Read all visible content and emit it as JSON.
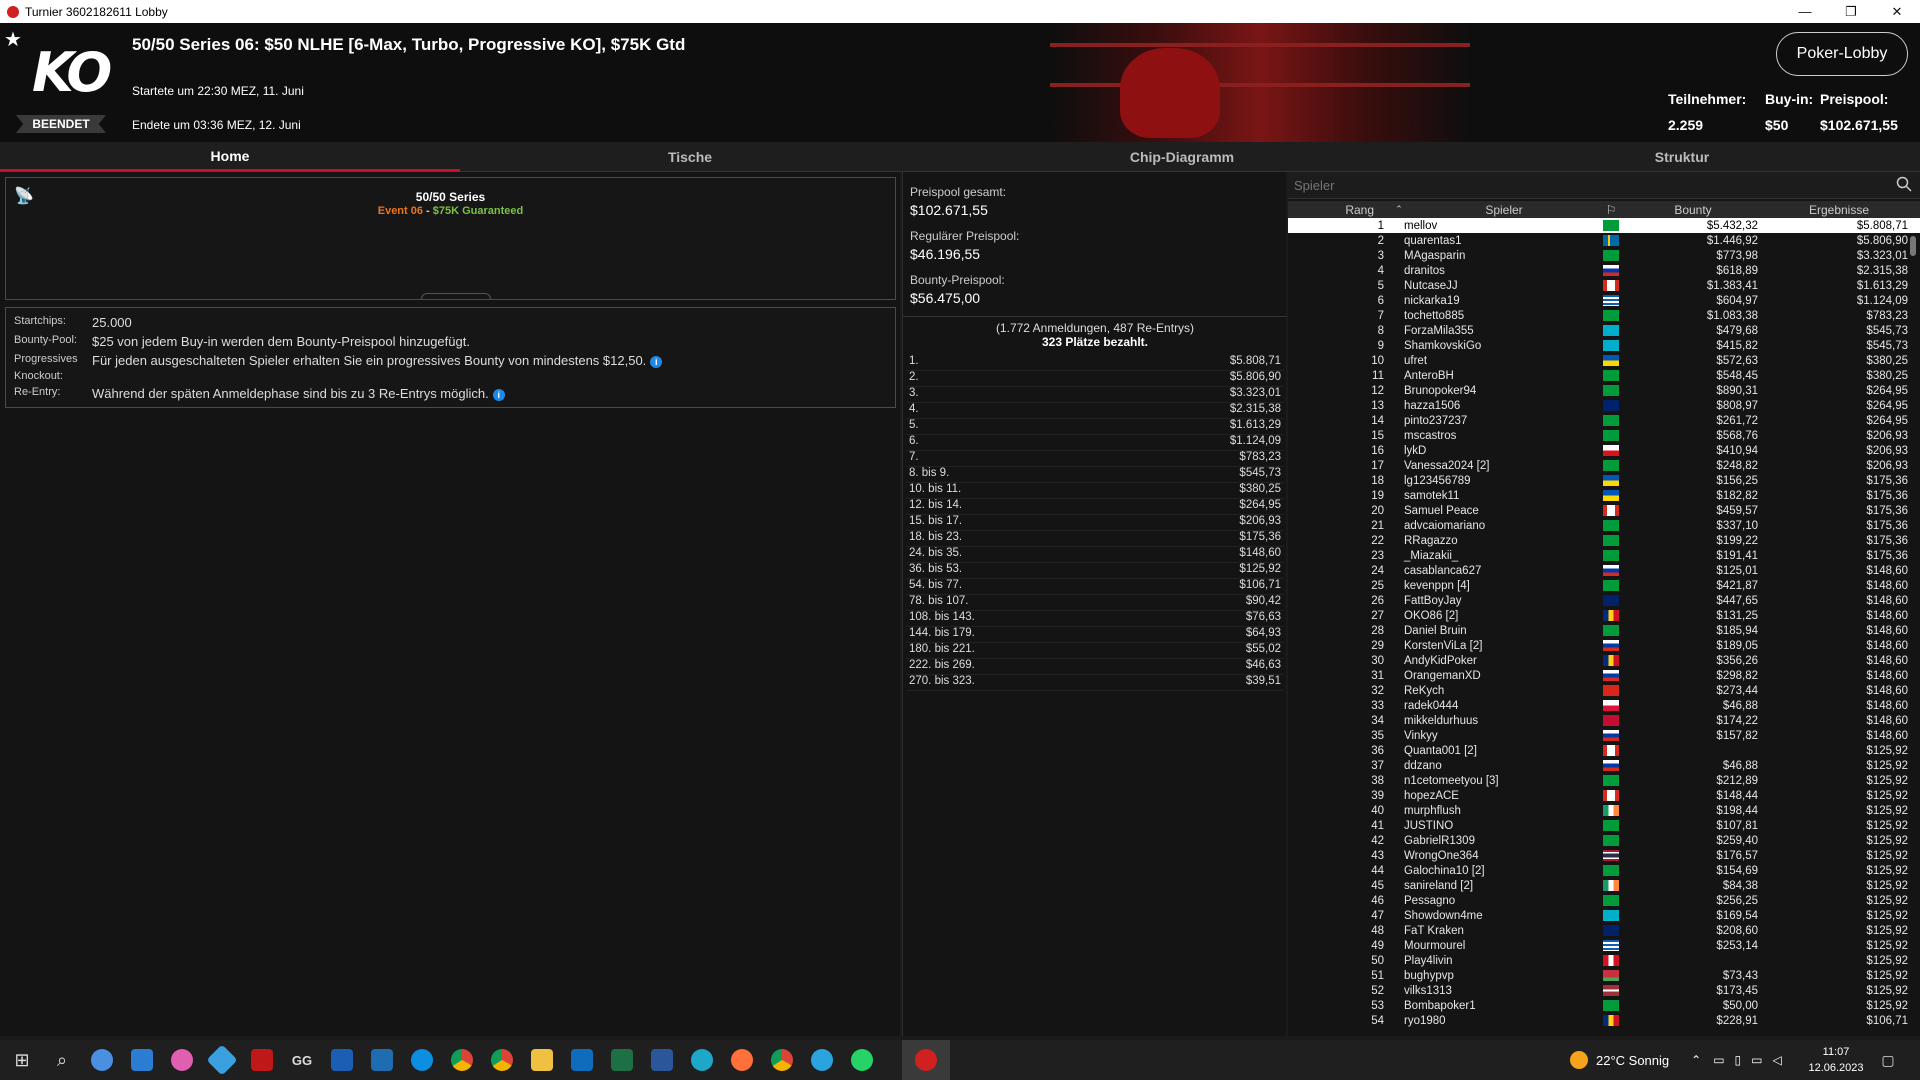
{
  "window": {
    "title": "Turnier 3602182611 Lobby",
    "min": "—",
    "max": "❐",
    "close": "✕"
  },
  "header": {
    "logo": "KO",
    "status_badge": "BEENDET",
    "title": "50/50 Series 06: $50 NLHE [6-Max, Turbo, Progressive KO], $75K Gtd",
    "start": "Startete um 22:30 MEZ, 11. Juni",
    "end": "Endete um 03:36 MEZ, 12. Juni",
    "lobby_button": "Poker-Lobby",
    "stats": {
      "participants_label": "Teilnehmer:",
      "participants": "2.259",
      "buyin_label": "Buy-in:",
      "buyin": "$50",
      "prizepool_label": "Preispool:",
      "prizepool": "$102.671,55"
    }
  },
  "tabs": [
    {
      "label": "Home",
      "active": true
    },
    {
      "label": "Tische"
    },
    {
      "label": "Chip-Diagramm"
    },
    {
      "label": "Struktur"
    }
  ],
  "series": {
    "name": "50/50 Series",
    "event": "Event 06",
    "dash": " - ",
    "guarantee": "$75K Guaranteed"
  },
  "info": [
    {
      "key": "Startchips:",
      "value": "25.000"
    },
    {
      "key": "Bounty-Pool:",
      "value": "$25 von jedem Buy-in werden dem Bounty-Preispool hinzugefügt."
    },
    {
      "key": "Progressives",
      "value": "Für jeden ausgeschalteten Spieler erhalten Sie ein progressives Bounty von mindestens $12,50."
    },
    {
      "key": "Knockout:",
      "value": ""
    },
    {
      "key": "Re-Entry:",
      "value": "Während der späten Anmeldephase sind bis zu 3 Re-Entrys möglich."
    }
  ],
  "pools": {
    "total_label": "Preispool gesamt:",
    "total": "$102.671,55",
    "regular_label": "Regulärer Preispool:",
    "regular": "$46.196,55",
    "bounty_label": "Bounty-Preispool:",
    "bounty": "$56.475,00"
  },
  "registrations": {
    "summary": "(1.772 Anmeldungen, 487 Re-Entrys)",
    "paid": "323 Plätze bezahlt."
  },
  "payouts": [
    [
      "1.",
      "$5.808,71"
    ],
    [
      "2.",
      "$5.806,90"
    ],
    [
      "3.",
      "$3.323,01"
    ],
    [
      "4.",
      "$2.315,38"
    ],
    [
      "5.",
      "$1.613,29"
    ],
    [
      "6.",
      "$1.124,09"
    ],
    [
      "7.",
      "$783,23"
    ],
    [
      "8. bis 9.",
      "$545,73"
    ],
    [
      "10. bis 11.",
      "$380,25"
    ],
    [
      "12. bis 14.",
      "$264,95"
    ],
    [
      "15. bis 17.",
      "$206,93"
    ],
    [
      "18. bis 23.",
      "$175,36"
    ],
    [
      "24. bis 35.",
      "$148,60"
    ],
    [
      "36. bis 53.",
      "$125,92"
    ],
    [
      "54. bis 77.",
      "$106,71"
    ],
    [
      "78. bis 107.",
      "$90,42"
    ],
    [
      "108. bis 143.",
      "$76,63"
    ],
    [
      "144. bis 179.",
      "$64,93"
    ],
    [
      "180. bis 221.",
      "$55,02"
    ],
    [
      "222. bis 269.",
      "$46,63"
    ],
    [
      "270. bis 323.",
      "$39,51"
    ]
  ],
  "players_search": {
    "placeholder": "Spieler"
  },
  "players_header": {
    "rank": "Rang",
    "player": "Spieler",
    "bounty": "Bounty",
    "result": "Ergebnisse"
  },
  "players": [
    [
      "1",
      "mellov",
      "br",
      "$5.432,32",
      "$5.808,71"
    ],
    [
      "2",
      "quarentas1",
      "se",
      "$1.446,92",
      "$5.806,90"
    ],
    [
      "3",
      "MAgasparin",
      "br",
      "$773,98",
      "$3.323,01"
    ],
    [
      "4",
      "dranitos",
      "ru",
      "$618,89",
      "$2.315,38"
    ],
    [
      "5",
      "NutcaseJJ",
      "ca",
      "$1.383,41",
      "$1.613,29"
    ],
    [
      "6",
      "nickarka19",
      "gr",
      "$604,97",
      "$1.124,09"
    ],
    [
      "7",
      "tochetto885",
      "br",
      "$1.083,38",
      "$783,23"
    ],
    [
      "8",
      "ForzaMila355",
      "kz",
      "$479,68",
      "$545,73"
    ],
    [
      "9",
      "ShamkovskiGo",
      "kz",
      "$415,82",
      "$545,73"
    ],
    [
      "10",
      "ufret",
      "ua",
      "$572,63",
      "$380,25"
    ],
    [
      "11",
      "AnteroBH",
      "br",
      "$548,45",
      "$380,25"
    ],
    [
      "12",
      "Brunopoker94",
      "br",
      "$890,31",
      "$264,95"
    ],
    [
      "13",
      "hazza1506",
      "gb",
      "$808,97",
      "$264,95"
    ],
    [
      "14",
      "pinto237237",
      "br",
      "$261,72",
      "$264,95"
    ],
    [
      "15",
      "mscastros",
      "br",
      "$568,76",
      "$206,93"
    ],
    [
      "16",
      "lykD",
      "cz",
      "$410,94",
      "$206,93"
    ],
    [
      "17",
      "Vanessa2024 [2]",
      "br",
      "$248,82",
      "$206,93"
    ],
    [
      "18",
      "lg123456789",
      "ua",
      "$156,25",
      "$175,36"
    ],
    [
      "19",
      "samotek11",
      "ua",
      "$182,82",
      "$175,36"
    ],
    [
      "20",
      "Samuel Peace",
      "ca",
      "$459,57",
      "$175,36"
    ],
    [
      "21",
      "advcaiomariano",
      "br",
      "$337,10",
      "$175,36"
    ],
    [
      "22",
      "RRagazzo",
      "br",
      "$199,22",
      "$175,36"
    ],
    [
      "23",
      "_Miazakii_",
      "br",
      "$191,41",
      "$175,36"
    ],
    [
      "24",
      "casablanca627",
      "ru",
      "$125,01",
      "$148,60"
    ],
    [
      "25",
      "kevenppn [4]",
      "br",
      "$421,87",
      "$148,60"
    ],
    [
      "26",
      "FattBoyJay",
      "gb",
      "$447,65",
      "$148,60"
    ],
    [
      "27",
      "OKO86 [2]",
      "ro",
      "$131,25",
      "$148,60"
    ],
    [
      "28",
      "Daniel Bruin",
      "br",
      "$185,94",
      "$148,60"
    ],
    [
      "29",
      "KorstenViLa [2]",
      "ru",
      "$189,05",
      "$148,60"
    ],
    [
      "30",
      "AndyKidPoker",
      "ro",
      "$356,26",
      "$148,60"
    ],
    [
      "31",
      "OrangemanXD",
      "ru",
      "$298,82",
      "$148,60"
    ],
    [
      "32",
      "ReKych",
      "vn",
      "$273,44",
      "$148,60"
    ],
    [
      "33",
      "radek0444",
      "pl",
      "$46,88",
      "$148,60"
    ],
    [
      "34",
      "mikkeldurhuus",
      "dk",
      "$174,22",
      "$148,60"
    ],
    [
      "35",
      "Vinkyy",
      "ru",
      "$157,82",
      "$148,60"
    ],
    [
      "36",
      "Quanta001 [2]",
      "ca",
      "",
      "$125,92"
    ],
    [
      "37",
      "ddzano",
      "ru",
      "$46,88",
      "$125,92"
    ],
    [
      "38",
      "n1cetomeetyou [3]",
      "br",
      "$212,89",
      "$125,92"
    ],
    [
      "39",
      "hopezACE",
      "ca",
      "$148,44",
      "$125,92"
    ],
    [
      "40",
      "murphflush",
      "ie",
      "$198,44",
      "$125,92"
    ],
    [
      "41",
      "JUSTINO",
      "br",
      "$107,81",
      "$125,92"
    ],
    [
      "42",
      "GabrielR1309",
      "br",
      "$259,40",
      "$125,92"
    ],
    [
      "43",
      "WrongOne364",
      "th",
      "$176,57",
      "$125,92"
    ],
    [
      "44",
      "Galochina10 [2]",
      "br",
      "$154,69",
      "$125,92"
    ],
    [
      "45",
      "sanireland [2]",
      "ie",
      "$84,38",
      "$125,92"
    ],
    [
      "46",
      "Pessagno",
      "br",
      "$256,25",
      "$125,92"
    ],
    [
      "47",
      "Showdown4me",
      "kz",
      "$169,54",
      "$125,92"
    ],
    [
      "48",
      "FaT Kraken",
      "gb",
      "$208,60",
      "$125,92"
    ],
    [
      "49",
      "Mourmourel",
      "gr",
      "$253,14",
      "$125,92"
    ],
    [
      "50",
      "Play4livin",
      "pe",
      "",
      "$125,92"
    ],
    [
      "51",
      "bughypvp",
      "by",
      "$73,43",
      "$125,92"
    ],
    [
      "52",
      "vilks1313",
      "lv",
      "$173,45",
      "$125,92"
    ],
    [
      "53",
      "Bombapoker1",
      "br",
      "$50,00",
      "$125,92"
    ],
    [
      "54",
      "ryo1980",
      "ro",
      "$228,91",
      "$106,71"
    ]
  ],
  "taskbar": {
    "weather": "22°C  Sonnig",
    "time": "11:07",
    "date": "12.06.2023"
  },
  "colors": {
    "accent": "#c8102e",
    "event_orange": "#e8741e",
    "guarantee_green": "#7ac143",
    "info_blue": "#1e88e5"
  }
}
